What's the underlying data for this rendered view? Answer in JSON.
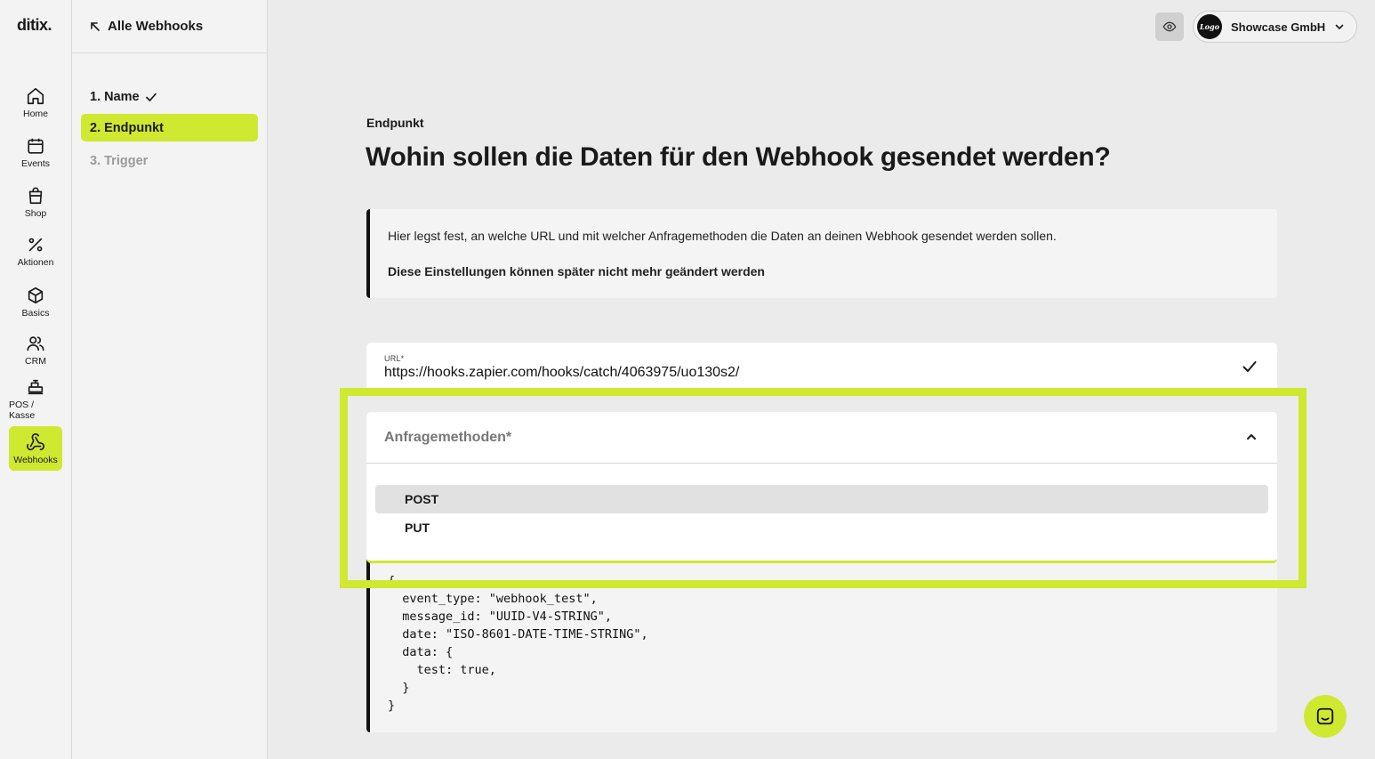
{
  "brand": {
    "logo_text": "ditix.",
    "accent": "#cfe830"
  },
  "nav": [
    {
      "label": "Home",
      "icon": "home-icon"
    },
    {
      "label": "Events",
      "icon": "calendar-icon"
    },
    {
      "label": "Shop",
      "icon": "shopping-bag-icon"
    },
    {
      "label": "Aktionen",
      "icon": "percent-icon"
    },
    {
      "label": "Basics",
      "icon": "cube-icon"
    },
    {
      "label": "CRM",
      "icon": "users-icon"
    },
    {
      "label": "POS / Kasse",
      "icon": "cash-register-icon"
    },
    {
      "label": "Webhooks",
      "icon": "webhook-icon",
      "active": true
    }
  ],
  "steps": {
    "back_label": "Alle Webhooks",
    "items": [
      {
        "label": "1. Name",
        "state": "done"
      },
      {
        "label": "2. Endpunkt",
        "state": "active"
      },
      {
        "label": "3. Trigger",
        "state": "disabled"
      }
    ]
  },
  "header": {
    "org_name": "Showcase GmbH",
    "org_logo_text": "Logo"
  },
  "main": {
    "kicker": "Endpunkt",
    "title": "Wohin sollen die Daten für den Webhook gesendet werden?",
    "info_text": "Hier legst fest, an welche URL und mit welcher Anfragemethoden die Daten an deinen Webhook gesendet werden sollen.",
    "info_note": "Diese Einstellungen können später nicht mehr geändert werden",
    "url_label": "URL*",
    "url_value": "https://hooks.zapier.com/hooks/catch/4063975/uo130s2/",
    "method_label": "Anfragemethoden*",
    "method_options": [
      "POST",
      "PUT"
    ],
    "code_sample": "{\n  event_type: \"webhook_test\",\n  message_id: \"UUID-V4-STRING\",\n  date: \"ISO-8601-DATE-TIME-STRING\",\n  data: {\n    test: true,\n  }\n}"
  }
}
